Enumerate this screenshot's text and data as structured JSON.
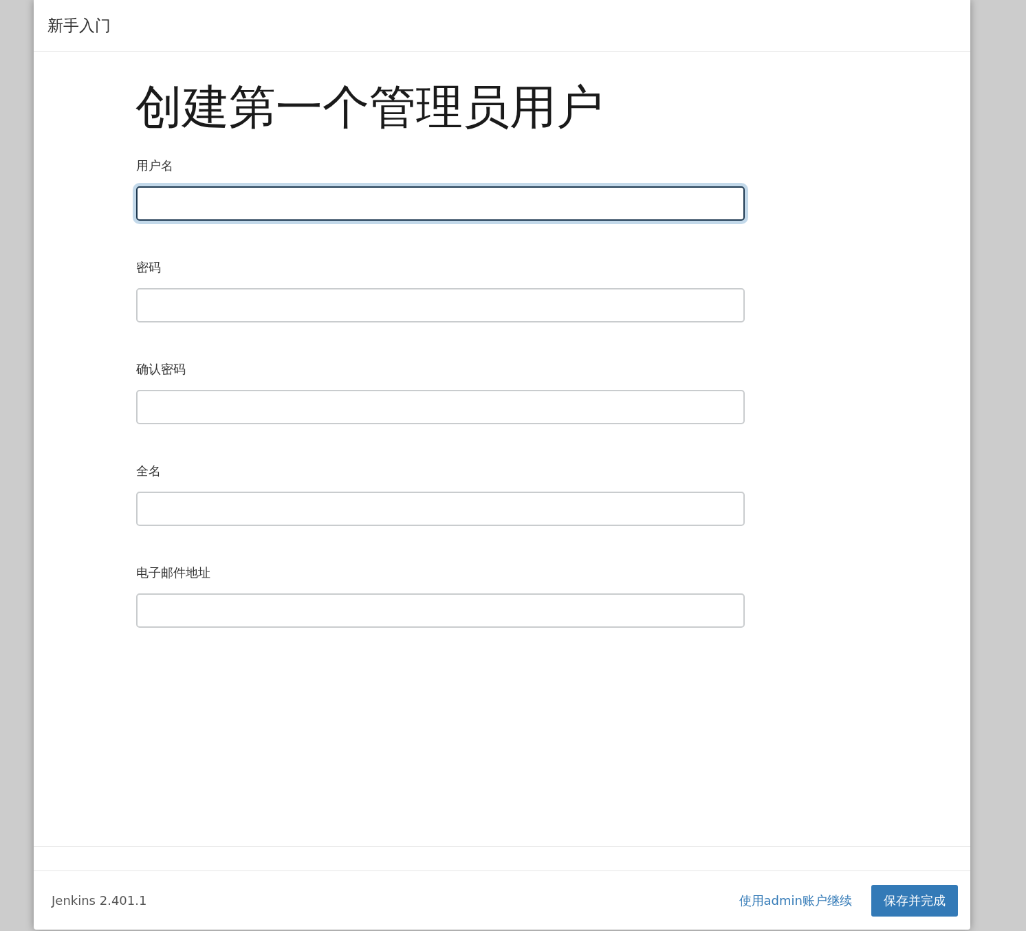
{
  "dialog": {
    "title": "新手入门"
  },
  "heading": "创建第一个管理员用户",
  "fields": [
    {
      "label": "用户名",
      "focused": true
    },
    {
      "label": "密码",
      "focused": false
    },
    {
      "label": "确认密码",
      "focused": false
    },
    {
      "label": "全名",
      "focused": false
    },
    {
      "label": "电子邮件地址",
      "focused": false
    }
  ],
  "footer": {
    "version": "Jenkins 2.401.1",
    "link": "使用admin账户继续",
    "button": "保存并完成"
  }
}
